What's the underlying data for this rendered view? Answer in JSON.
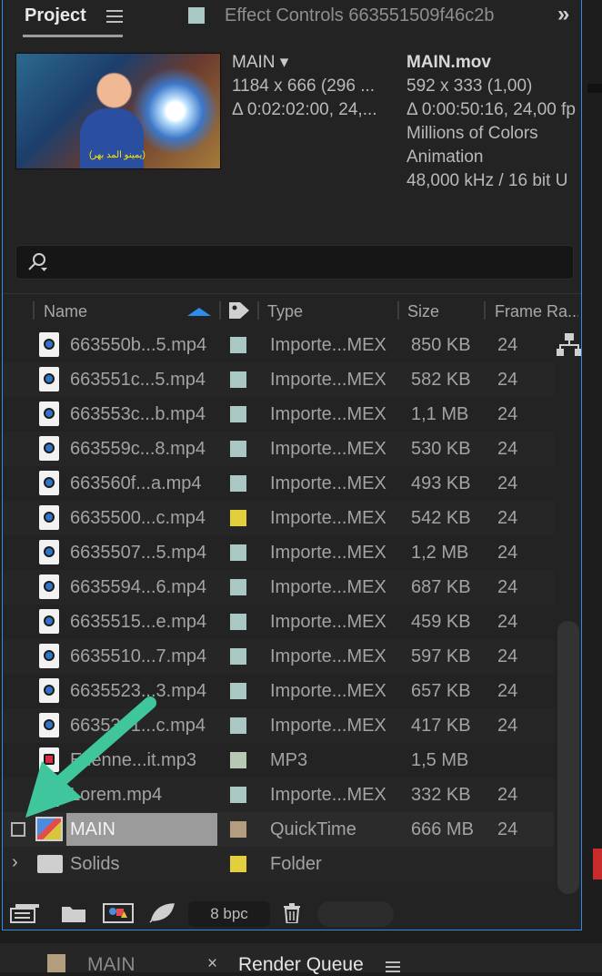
{
  "tabs": {
    "project": "Project",
    "effect_controls": "Effect Controls 663551509f46c2b"
  },
  "preview": {
    "comp_name": "MAIN ▾",
    "comp_dims": "1184 x 666  (296 ...",
    "comp_duration": "Δ 0:02:02:00, 24,...",
    "file_name": "MAIN.mov",
    "file_dims": "592 x 333 (1,00)",
    "file_duration": "Δ 0:00:50:16, 24,00 fp",
    "file_colors": "Millions of Colors",
    "file_codec": "Animation",
    "file_audio": "48,000 kHz / 16 bit U"
  },
  "columns": {
    "name": "Name",
    "type": "Type",
    "size": "Size",
    "frame_rate": "Frame Ra..."
  },
  "rows": [
    {
      "name": "663550b...5.mp4",
      "label": "#a9c8c3",
      "type": "Importe...MEX",
      "size": "850 KB",
      "fr": "24",
      "icon": "video"
    },
    {
      "name": "663551c...5.mp4",
      "label": "#a9c8c3",
      "type": "Importe...MEX",
      "size": "582 KB",
      "fr": "24",
      "icon": "video"
    },
    {
      "name": "663553c...b.mp4",
      "label": "#a9c8c3",
      "type": "Importe...MEX",
      "size": "1,1 MB",
      "fr": "24",
      "icon": "video"
    },
    {
      "name": "663559c...8.mp4",
      "label": "#a9c8c3",
      "type": "Importe...MEX",
      "size": "530 KB",
      "fr": "24",
      "icon": "video"
    },
    {
      "name": "663560f...a.mp4",
      "label": "#a9c8c3",
      "type": "Importe...MEX",
      "size": "493 KB",
      "fr": "24",
      "icon": "video"
    },
    {
      "name": "6635500...c.mp4",
      "label": "#e2cf3e",
      "type": "Importe...MEX",
      "size": "542 KB",
      "fr": "24",
      "icon": "video"
    },
    {
      "name": "6635507...5.mp4",
      "label": "#a9c8c3",
      "type": "Importe...MEX",
      "size": "1,2 MB",
      "fr": "24",
      "icon": "video"
    },
    {
      "name": "6635594...6.mp4",
      "label": "#a9c8c3",
      "type": "Importe...MEX",
      "size": "687 KB",
      "fr": "24",
      "icon": "video"
    },
    {
      "name": "6635515...e.mp4",
      "label": "#a9c8c3",
      "type": "Importe...MEX",
      "size": "459 KB",
      "fr": "24",
      "icon": "video"
    },
    {
      "name": "6635510...7.mp4",
      "label": "#a9c8c3",
      "type": "Importe...MEX",
      "size": "597 KB",
      "fr": "24",
      "icon": "video"
    },
    {
      "name": "6635523...3.mp4",
      "label": "#a9c8c3",
      "type": "Importe...MEX",
      "size": "657 KB",
      "fr": "24",
      "icon": "video"
    },
    {
      "name": "6635301...c.mp4",
      "label": "#a9c8c3",
      "type": "Importe...MEX",
      "size": "417 KB",
      "fr": "24",
      "icon": "video"
    },
    {
      "name": "Etienne...it.mp3",
      "label": "#b7c9b4",
      "type": "MP3",
      "size": "1,5 MB",
      "fr": "",
      "icon": "audio"
    },
    {
      "name": "Lorem.mp4",
      "label": "#a9c8c3",
      "type": "Importe...MEX",
      "size": "332 KB",
      "fr": "24",
      "icon": "video"
    }
  ],
  "main_row": {
    "name": "MAIN",
    "label": "#b49d7e",
    "type": "QuickTime",
    "size": "666 MB",
    "fr": "24"
  },
  "folder_row": {
    "name": "Solids",
    "label": "#e2cf3e",
    "type": "Folder"
  },
  "toolbar": {
    "bpc": "8 bpc"
  },
  "bottom_tabs": {
    "main": "MAIN",
    "render_queue": "Render Queue"
  },
  "colors": {
    "accent": "#2d8ceb",
    "arrow": "#3fc69c"
  }
}
